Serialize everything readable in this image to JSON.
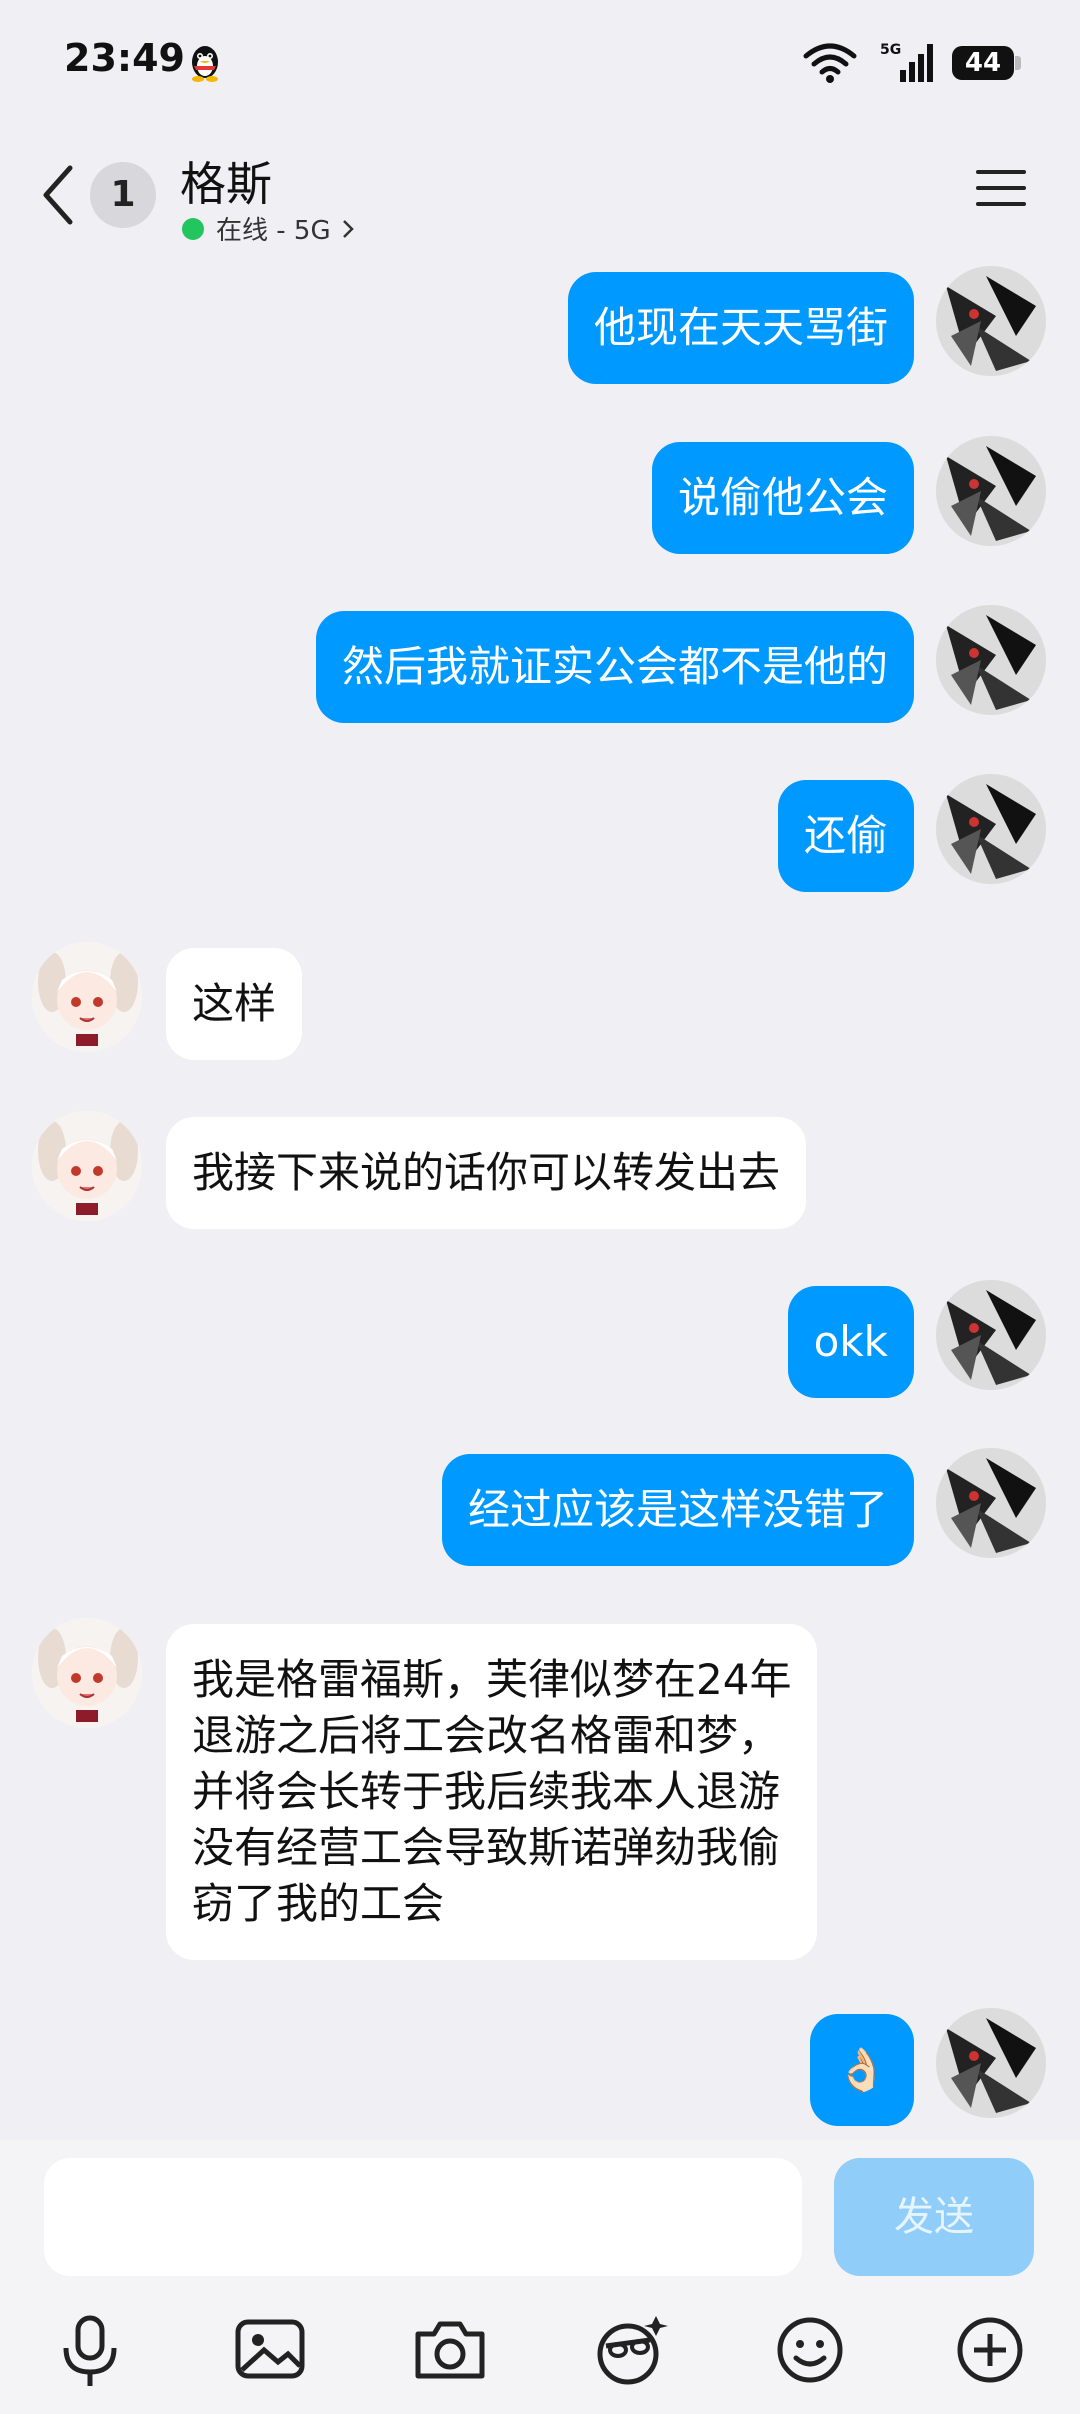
{
  "status_bar": {
    "time": "23:49",
    "battery": "44",
    "network": "5G"
  },
  "header": {
    "back_badge": "1",
    "contact_name": "格斯",
    "presence": "在线 - 5G"
  },
  "messages": [
    {
      "dir": "out",
      "text": "他现在天天骂街"
    },
    {
      "dir": "out",
      "text": "说偷他公会"
    },
    {
      "dir": "out",
      "text": "然后我就证实公会都不是他的"
    },
    {
      "dir": "out",
      "text": "还偷"
    },
    {
      "dir": "in",
      "text": "这样"
    },
    {
      "dir": "in",
      "text": "我接下来说的话你可以转发出去"
    },
    {
      "dir": "out",
      "text": "okk"
    },
    {
      "dir": "out",
      "text": "经过应该是这样没错了"
    },
    {
      "dir": "in",
      "lines": [
        "我是格雷福斯，芙律似梦在24年",
        "退游之后将工会改名格雷和梦，",
        "并将会长转于我后续我本人退游",
        "没有经营工会导致斯诺弹劾我偷",
        "窃了我的工会"
      ]
    },
    {
      "dir": "out",
      "text": "👌🏻"
    }
  ],
  "input": {
    "placeholder": "",
    "send_label": "发送"
  },
  "toolbar": [
    "microphone-icon",
    "image-icon",
    "camera-icon",
    "sticker-icon",
    "emoji-icon",
    "plus-icon"
  ],
  "colors": {
    "outgoing": "#0099ff",
    "incoming": "#ffffff",
    "background": "#efeff4",
    "send_disabled": "#90cdf8"
  }
}
